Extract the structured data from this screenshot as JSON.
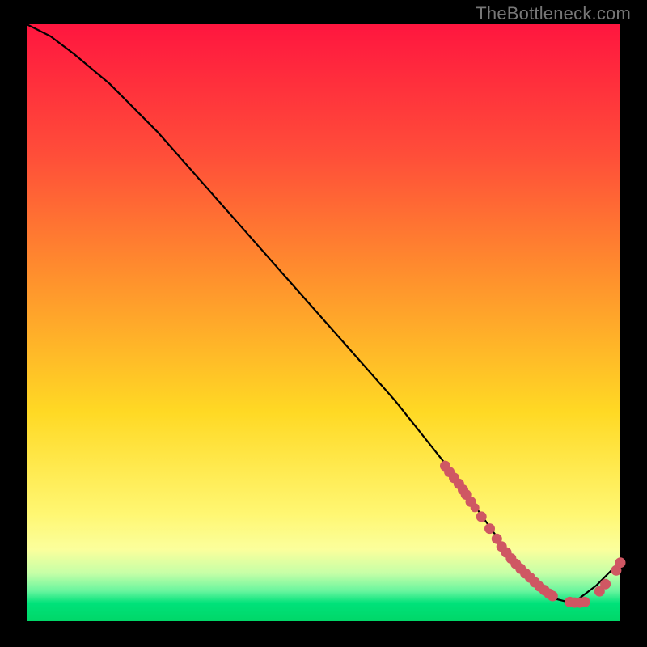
{
  "watermark": "TheBottleneck.com",
  "chart_data": {
    "type": "line",
    "title": "",
    "xlabel": "",
    "ylabel": "",
    "xlim": [
      0,
      100
    ],
    "ylim": [
      0,
      100
    ],
    "grid": false,
    "curve": {
      "x": [
        0,
        4,
        8,
        14,
        22,
        30,
        38,
        46,
        54,
        62,
        70,
        75,
        80,
        84,
        88,
        92,
        96,
        100
      ],
      "y": [
        100,
        98,
        95,
        90,
        82,
        73,
        64,
        55,
        46,
        37,
        27,
        20,
        13,
        8,
        4,
        3,
        6,
        10
      ]
    },
    "markers_main": {
      "x": [
        70.5,
        71.2,
        72.0,
        72.8,
        73.5,
        74.0,
        74.8,
        76.6,
        78.0,
        79.2,
        80.0,
        80.8,
        81.6,
        82.4,
        83.2,
        84.0,
        84.8,
        85.6,
        86.4,
        87.2,
        88.0,
        88.6,
        91.5,
        92.3,
        93.2,
        94.0,
        96.5,
        97.5,
        99.3,
        100.0
      ],
      "y": [
        26.0,
        25.0,
        24.0,
        23.0,
        22.0,
        21.2,
        20.0,
        17.5,
        15.5,
        13.8,
        12.5,
        11.5,
        10.5,
        9.6,
        8.8,
        8.0,
        7.3,
        6.5,
        5.8,
        5.2,
        4.6,
        4.2,
        3.2,
        3.1,
        3.1,
        3.2,
        5.0,
        6.2,
        8.5,
        9.8
      ]
    },
    "markers_accent": {
      "x": [
        75.5
      ],
      "y": [
        19.0
      ]
    },
    "colors": {
      "curve": "#000000",
      "marker": "#cf5763",
      "accent_marker": "#cf5763",
      "gradient_top": "#ff163f",
      "gradient_bottom": "#00d768"
    }
  }
}
